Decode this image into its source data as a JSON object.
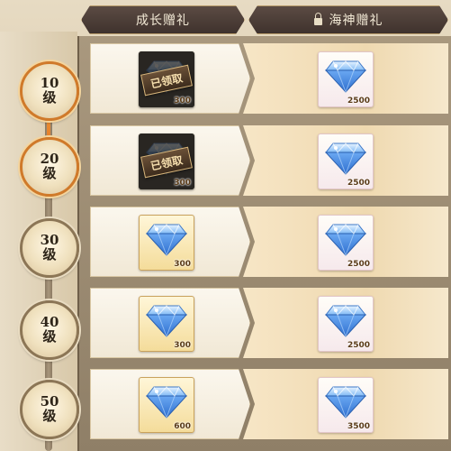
{
  "tabs": {
    "growth": {
      "label": "成长赠礼"
    },
    "sea_god": {
      "label": "海神赠礼",
      "locked": true,
      "icon": "lock-icon"
    }
  },
  "claimed_stamp": "已领取",
  "levels": [
    {
      "num": "10",
      "unit": "级",
      "active": true,
      "growth": {
        "icon": "diamond-icon",
        "qty": "300",
        "claimed": true
      },
      "premium": {
        "icon": "diamond-icon",
        "qty": "2500"
      }
    },
    {
      "num": "20",
      "unit": "级",
      "active": true,
      "growth": {
        "icon": "diamond-icon",
        "qty": "300",
        "claimed": true
      },
      "premium": {
        "icon": "diamond-icon",
        "qty": "2500"
      }
    },
    {
      "num": "30",
      "unit": "级",
      "active": false,
      "growth": {
        "icon": "diamond-icon",
        "qty": "300",
        "claimed": false
      },
      "premium": {
        "icon": "diamond-icon",
        "qty": "2500"
      }
    },
    {
      "num": "40",
      "unit": "级",
      "active": false,
      "growth": {
        "icon": "diamond-icon",
        "qty": "300",
        "claimed": false
      },
      "premium": {
        "icon": "diamond-icon",
        "qty": "2500"
      }
    },
    {
      "num": "50",
      "unit": "级",
      "active": false,
      "growth": {
        "icon": "diamond-icon",
        "qty": "600",
        "claimed": false
      },
      "premium": {
        "icon": "diamond-icon",
        "qty": "3500"
      }
    }
  ],
  "colors": {
    "accent": "#e0731f",
    "tab_bg": "#4b3c35",
    "gem": "#5aa0f0"
  }
}
